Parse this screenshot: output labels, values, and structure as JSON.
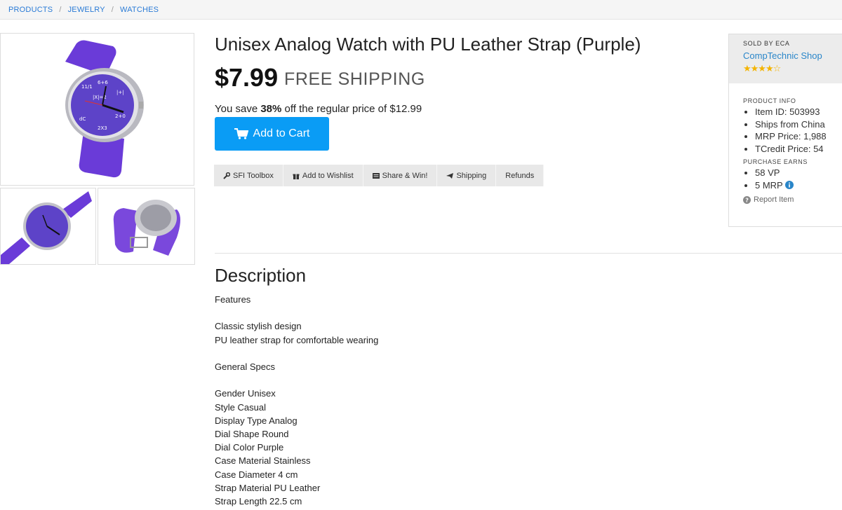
{
  "breadcrumb": {
    "items": [
      "PRODUCTS",
      "JEWELRY",
      "WATCHES"
    ],
    "sep": "/"
  },
  "product": {
    "title": "Unisex Analog Watch with PU Leather Strap (Purple)",
    "price": "$7.99",
    "shipping": "FREE SHIPPING",
    "save_prefix": "You save ",
    "save_pct": "38%",
    "save_suffix": " off the regular price of $12.99",
    "cart_label": "Add to Cart"
  },
  "tools": [
    {
      "label": "SFI Toolbox",
      "icon": "wrench-icon"
    },
    {
      "label": "Add to Wishlist",
      "icon": "gift-icon"
    },
    {
      "label": "Share & Win!",
      "icon": "share-icon"
    },
    {
      "label": "Shipping",
      "icon": "plane-icon"
    },
    {
      "label": "Refunds",
      "icon": ""
    }
  ],
  "sidebar": {
    "sold_by": "SOLD BY ECA",
    "shop": "CompTechnic Shop",
    "stars": "★★★★☆",
    "product_info_label": "PRODUCT INFO",
    "info": [
      "Item ID: 503993",
      "Ships from China",
      "MRP Price: 1,988",
      "TCredit Price: 54"
    ],
    "earns_label": "PURCHASE EARNS",
    "earns": [
      "58 VP",
      "5 MRP"
    ],
    "report": "Report Item"
  },
  "description": {
    "heading": "Description",
    "lines": [
      "Features",
      "",
      "Classic stylish design",
      "PU leather strap for comfortable wearing",
      "",
      "General Specs",
      "",
      "Gender Unisex",
      "Style Casual",
      "Display Type Analog",
      "Dial Shape Round",
      "Dial Color Purple",
      "Case Material Stainless",
      "Case Diameter 4 cm",
      "Strap Material PU Leather",
      "Strap Length 22.5 cm"
    ]
  },
  "colors": {
    "accent": "#0a9cf5",
    "link": "#2a7bd6",
    "watch": "#6a3bd8",
    "star": "#f4b400"
  }
}
